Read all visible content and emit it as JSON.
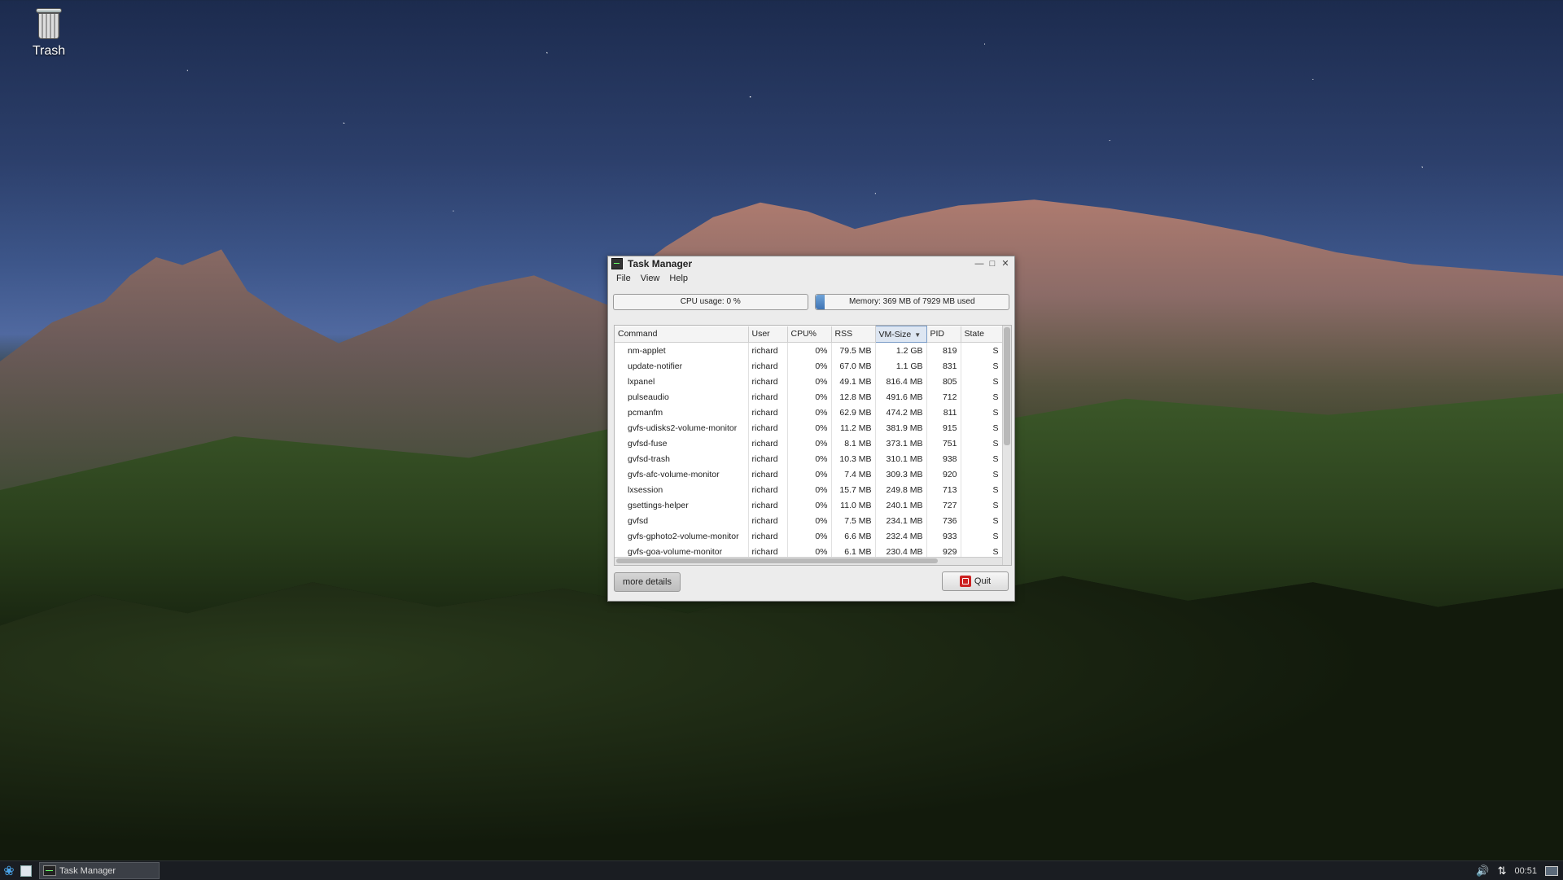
{
  "desktop": {
    "icons": [
      {
        "label": "Trash"
      }
    ]
  },
  "window": {
    "title": "Task Manager",
    "menu": [
      "File",
      "View",
      "Help"
    ],
    "cpu_meter": {
      "text": "CPU usage: 0 %",
      "fraction": 0.0
    },
    "memory_meter": {
      "text": "Memory: 369 MB of 7929 MB used",
      "fraction": 0.0465
    },
    "columns": [
      "Command",
      "User",
      "CPU%",
      "RSS",
      "VM-Size",
      "PID",
      "State"
    ],
    "sorted_column": "VM-Size",
    "rows": [
      {
        "command": "nm-applet",
        "user": "richard",
        "cpu": "0%",
        "rss": "79.5 MB",
        "vm": "1.2 GB",
        "pid": "819",
        "state": "S"
      },
      {
        "command": "update-notifier",
        "user": "richard",
        "cpu": "0%",
        "rss": "67.0 MB",
        "vm": "1.1 GB",
        "pid": "831",
        "state": "S"
      },
      {
        "command": "lxpanel",
        "user": "richard",
        "cpu": "0%",
        "rss": "49.1 MB",
        "vm": "816.4 MB",
        "pid": "805",
        "state": "S"
      },
      {
        "command": "pulseaudio",
        "user": "richard",
        "cpu": "0%",
        "rss": "12.8 MB",
        "vm": "491.6 MB",
        "pid": "712",
        "state": "S"
      },
      {
        "command": "pcmanfm",
        "user": "richard",
        "cpu": "0%",
        "rss": "62.9 MB",
        "vm": "474.2 MB",
        "pid": "811",
        "state": "S"
      },
      {
        "command": "gvfs-udisks2-volume-monitor",
        "user": "richard",
        "cpu": "0%",
        "rss": "11.2 MB",
        "vm": "381.9 MB",
        "pid": "915",
        "state": "S"
      },
      {
        "command": "gvfsd-fuse",
        "user": "richard",
        "cpu": "0%",
        "rss": "8.1 MB",
        "vm": "373.1 MB",
        "pid": "751",
        "state": "S"
      },
      {
        "command": "gvfsd-trash",
        "user": "richard",
        "cpu": "0%",
        "rss": "10.3 MB",
        "vm": "310.1 MB",
        "pid": "938",
        "state": "S"
      },
      {
        "command": "gvfs-afc-volume-monitor",
        "user": "richard",
        "cpu": "0%",
        "rss": "7.4 MB",
        "vm": "309.3 MB",
        "pid": "920",
        "state": "S"
      },
      {
        "command": "lxsession",
        "user": "richard",
        "cpu": "0%",
        "rss": "15.7 MB",
        "vm": "249.8 MB",
        "pid": "713",
        "state": "S"
      },
      {
        "command": "gsettings-helper",
        "user": "richard",
        "cpu": "0%",
        "rss": "11.0 MB",
        "vm": "240.1 MB",
        "pid": "727",
        "state": "S"
      },
      {
        "command": "gvfsd",
        "user": "richard",
        "cpu": "0%",
        "rss": "7.5 MB",
        "vm": "234.1 MB",
        "pid": "736",
        "state": "S"
      },
      {
        "command": "gvfs-gphoto2-volume-monitor",
        "user": "richard",
        "cpu": "0%",
        "rss": "6.6 MB",
        "vm": "232.4 MB",
        "pid": "933",
        "state": "S"
      },
      {
        "command": "gvfs-goa-volume-monitor",
        "user": "richard",
        "cpu": "0%",
        "rss": "6.1 MB",
        "vm": "230.4 MB",
        "pid": "929",
        "state": "S"
      }
    ],
    "buttons": {
      "more": "more details",
      "quit": "Quit"
    }
  },
  "taskbar": {
    "task_label": "Task Manager",
    "clock": "00:51"
  }
}
